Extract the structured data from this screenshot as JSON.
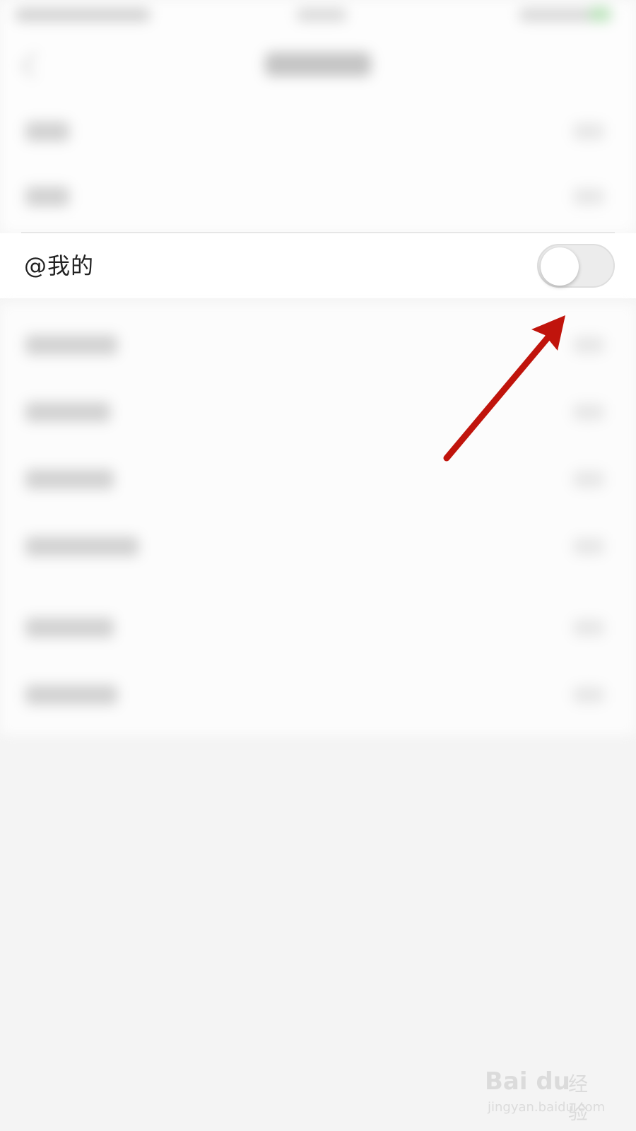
{
  "setting_row": {
    "label": "@我的",
    "toggle_on": false
  },
  "watermark": {
    "brand": "Bai du",
    "brand_cn": "经验",
    "url": "jingyan.baidu.com"
  },
  "colors": {
    "arrow": "#c0140c",
    "toggle_off_track": "#ececec",
    "page_bg": "#f4f4f4"
  }
}
